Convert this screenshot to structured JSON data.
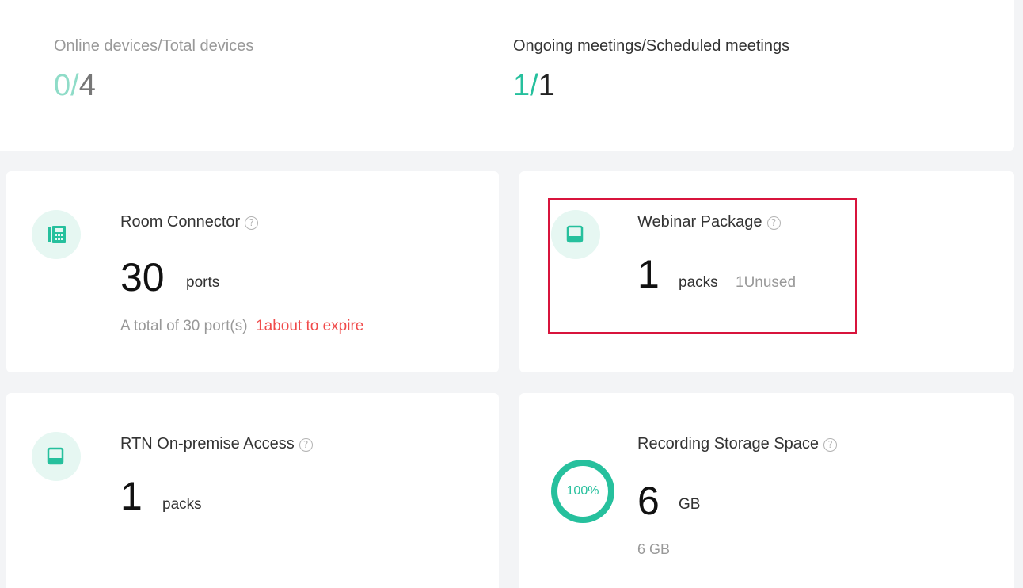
{
  "overview": {
    "devices": {
      "label": "Online devices/Total devices",
      "online": "0",
      "separator": "/",
      "total": "4"
    },
    "meetings": {
      "label": "Ongoing meetings/Scheduled meetings",
      "ongoing": "1",
      "separator": "/",
      "scheduled": "1"
    }
  },
  "cards": {
    "room_connector": {
      "icon": "phone-grid-icon",
      "title": "Room Connector",
      "help": "?",
      "value": "30",
      "unit": "ports",
      "detail": "A total of 30 port(s)",
      "warning": "1about to expire"
    },
    "webinar_package": {
      "icon": "package-icon",
      "title": "Webinar Package",
      "help": "?",
      "value": "1",
      "unit": "packs",
      "unused": "1Unused"
    },
    "rtn_access": {
      "icon": "package-icon",
      "title": "RTN On-premise Access",
      "help": "?",
      "value": "1",
      "unit": "packs"
    },
    "recording_storage": {
      "title": "Recording Storage Space",
      "help": "?",
      "percent_label": "100%",
      "percent": 100,
      "value": "6",
      "unit": "GB",
      "total": "6 GB"
    }
  },
  "colors": {
    "accent": "#26c09d",
    "accent_light": "#8fdcc8",
    "warning": "#f04a4a",
    "highlight": "#d8143c"
  }
}
